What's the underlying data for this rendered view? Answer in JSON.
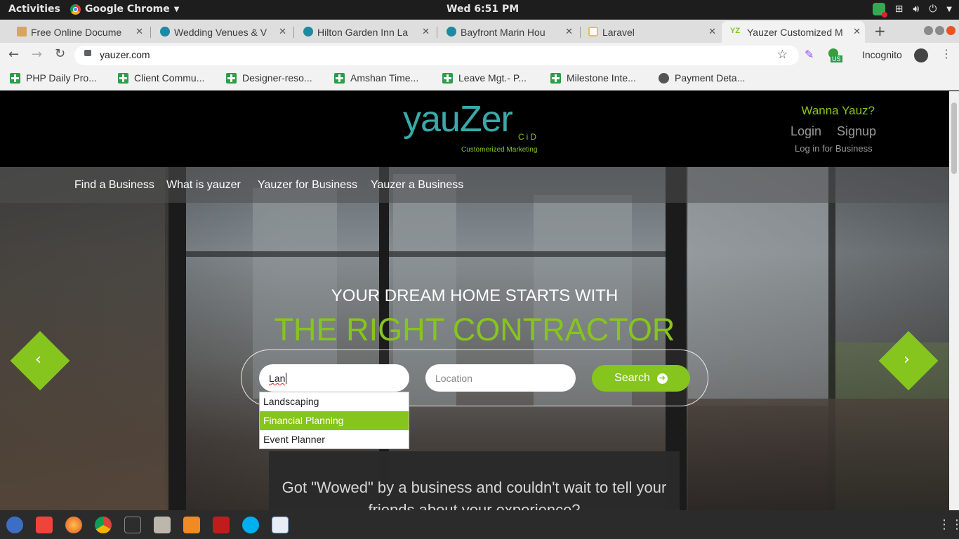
{
  "system": {
    "activities": "Activities",
    "app_name": "Google Chrome",
    "clock": "Wed  6:51 PM"
  },
  "tabs": [
    {
      "title": "Free Online Docume",
      "color": "#d8a65a"
    },
    {
      "title": "Wedding Venues & V",
      "color": "#1c8aa0"
    },
    {
      "title": "Hilton Garden Inn La",
      "color": "#1c8aa0"
    },
    {
      "title": "Bayfront Marin Hou",
      "color": "#1c8aa0"
    },
    {
      "title": "Laravel",
      "color": "#e6c340"
    },
    {
      "title": "Yauzer Customized M",
      "color": "#86c51e"
    }
  ],
  "address": {
    "url": "yauzer.com",
    "incognito": "Incognito",
    "extension_badge": "US"
  },
  "bookmarks": [
    "PHP Daily Pro...",
    "Client Commu...",
    "Designer-reso...",
    "Amshan Time...",
    "Leave Mgt.- P...",
    "Milestone Inte...",
    "Payment Deta..."
  ],
  "site": {
    "logo_text": "yauZer",
    "logo_cid": "CiD",
    "logo_tagline": "Customerized Marketing",
    "wanna": "Wanna Yauz?",
    "login": "Login",
    "signup": "Signup",
    "business_login": "Log in for Business",
    "nav": [
      "Find a Business",
      "What is yauzer",
      "Yauzer for Business",
      "Yauzer a Business"
    ],
    "hero_line1": "YOUR DREAM HOME STARTS WITH",
    "hero_line2": "THE RIGHT CONTRACTOR",
    "search_value": "Lan",
    "location_placeholder": "Location",
    "search_button": "Search",
    "suggestions": [
      "Landscaping",
      "Financial Planning",
      "Event Planner"
    ],
    "highlighted_suggestion": "Financial Planning",
    "wowed_text": "Got \"Wowed\" by a business and couldn't wait to tell your friends about your experience?",
    "accent_color": "#86c51e"
  },
  "dock": [
    "thunderbird",
    "anydesk",
    "firefox",
    "chrome",
    "terminal",
    "files",
    "sublime",
    "filezilla",
    "skype",
    "text-editor"
  ]
}
